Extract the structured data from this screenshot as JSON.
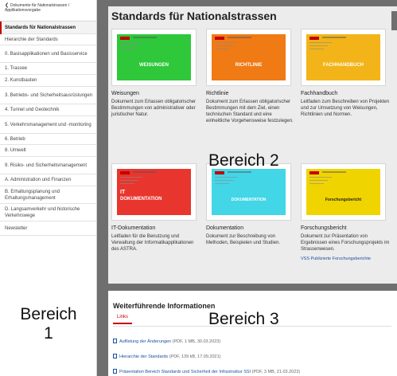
{
  "sidebar": {
    "back_link": "Dokumente für Nationalstrassen / Applikationsvorgabe",
    "items": [
      {
        "label": "Standards für Nationalstrassen",
        "active": true
      },
      {
        "label": "Hierarchie der Standards"
      },
      {
        "label": "0. Basisapplikationen und Basisservice"
      },
      {
        "label": "1. Trassee"
      },
      {
        "label": "2. Kunstbauten"
      },
      {
        "label": "3. Betriebs- und Sicherheitsausrüstungen"
      },
      {
        "label": "4. Tunnel und Geotechnik"
      },
      {
        "label": "5. Verkehrsmanagement und -monitoring"
      },
      {
        "label": "6. Betrieb"
      },
      {
        "label": "8. Umwelt"
      },
      {
        "label": "9. Risiko- und Sicherheitsmanagement"
      },
      {
        "label": "A. Administration und Finanzen"
      },
      {
        "label": "B. Erhaltungsplanung und Erhaltungsmanagement"
      },
      {
        "label": "D. Langsamverkehr und historische Verkehrswege"
      },
      {
        "label": "Newsletter"
      }
    ],
    "area_label_1": "Bereich",
    "area_label_2": "1"
  },
  "main": {
    "title": "Standards für Nationalstrassen",
    "area_label": "Bereich 2",
    "cards": [
      {
        "title": "Weisungen",
        "thumb_label": "WEISUNGEN",
        "color": "#2ec83a",
        "desc": "Dokument zum Erlassen obligatorischer Bestimmungen von administrativer oder juristischer Natur."
      },
      {
        "title": "Richtlinie",
        "thumb_label": "RICHTLINIE",
        "color": "#f07a14",
        "desc": "Dokument zum Erlassen obligatorischer Bestimmungen mit dem Ziel, einen technischen Standard und eine einheitliche Vorgehensweise festzulegen."
      },
      {
        "title": "Fachhandbuch",
        "thumb_label": "FACHHANDBUCH",
        "color": "#f2b418",
        "desc": "Leitfaden zum Beschreiben von Projekten und zur Umsetzung von Weisungen, Richtlinien und Normen."
      },
      {
        "title": "IT-Dokumentation",
        "thumb_label_1": "IT",
        "thumb_label_2": "DOKUMENTATION",
        "color": "#e8362e",
        "desc": "Leitfaden für die Benutzung und Verwaltung der Informatikapplikationen des ASTRA."
      },
      {
        "title": "Dokumentation",
        "thumb_label": "DOKUMENTATION",
        "color": "#42d6e6",
        "desc": "Dokument zur Beschreibung von Methoden, Beispielen und Studien."
      },
      {
        "title": "Forschungsbericht",
        "thumb_label": "Forschungsbericht",
        "color": "#f0d400",
        "desc": "Dokument zur Präsentation von Ergebnissen eines Forschungsprojekts im Strassenwesen.",
        "link": "VSS Publizierte Forschungsberichte"
      }
    ]
  },
  "section3": {
    "title": "Weiterführende Informationen",
    "area_label": "Bereich 3",
    "tab": "Links",
    "links": [
      {
        "label": "Auflistung der Änderungen",
        "meta": "(PDF, 1 MB, 30.03.2023)"
      },
      {
        "label": "Hierarchie der Standards",
        "meta": "(PDF, 139 kB, 17.09.2021)"
      },
      {
        "label": "Präsentation Bereich Standards und Sicherheit der Infrastruktur SSI",
        "meta": "(PDF, 3 MB, 21.03.2023)"
      }
    ]
  },
  "colors": {
    "accent": "#c40000",
    "link": "#1a4f9c",
    "separator": "#6f6f6f"
  }
}
